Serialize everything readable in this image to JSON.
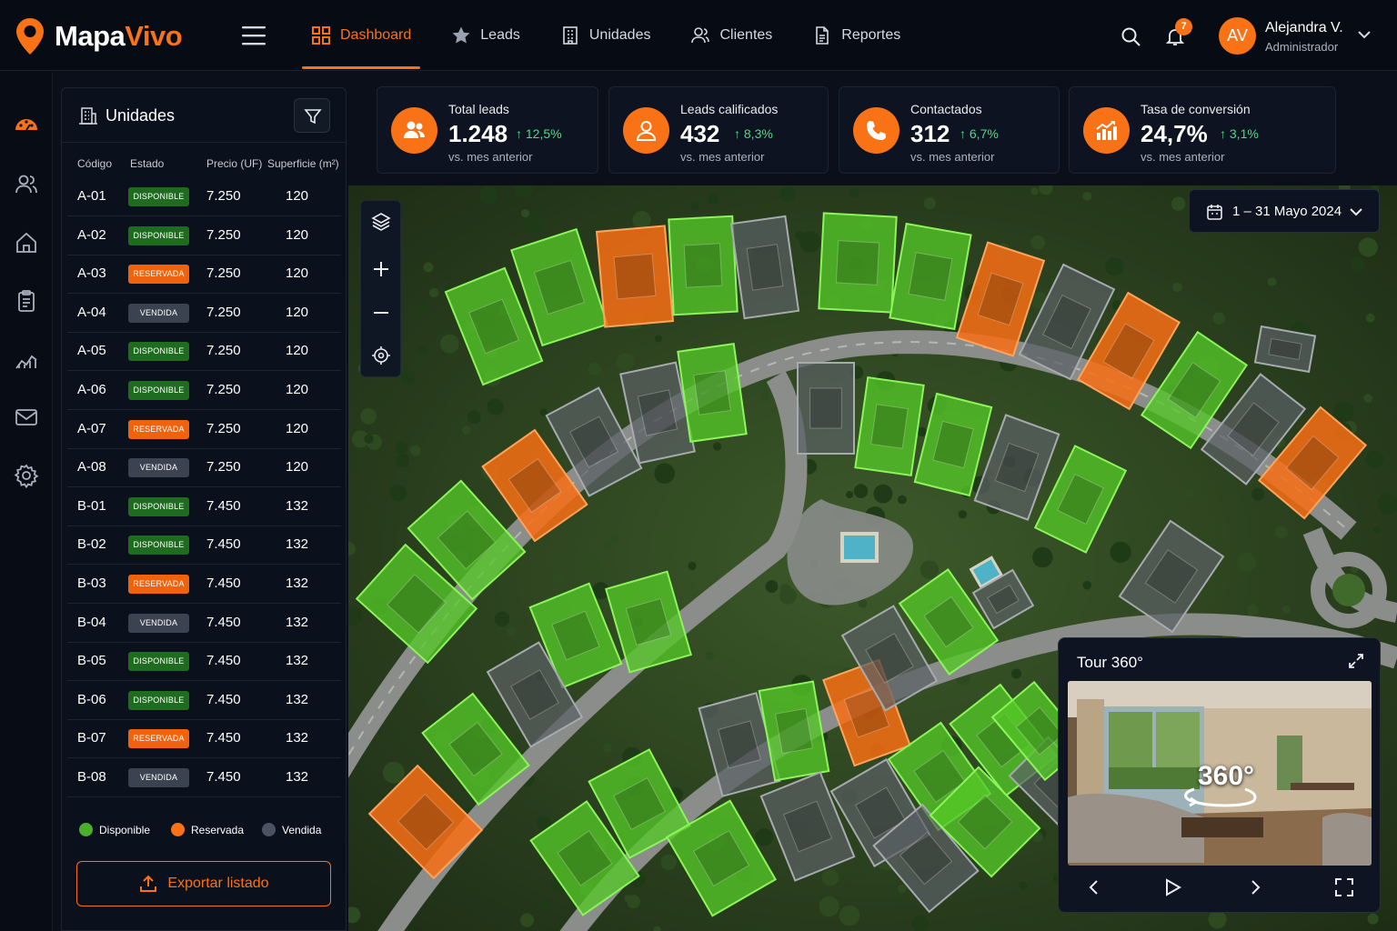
{
  "brand": {
    "name_a": "Mapa",
    "name_b": "Vivo",
    "accent": "#f97316"
  },
  "nav": [
    {
      "label": "Dashboard",
      "icon": "grid-icon",
      "active": true
    },
    {
      "label": "Leads",
      "icon": "star-icon"
    },
    {
      "label": "Unidades",
      "icon": "building-icon"
    },
    {
      "label": "Clientes",
      "icon": "users-icon"
    },
    {
      "label": "Reportes",
      "icon": "document-icon"
    }
  ],
  "user": {
    "initials": "AV",
    "name": "Alejandra V.",
    "role": "Administrador",
    "notifications": "7"
  },
  "rail": [
    "dashboard-icon",
    "users-icon",
    "home-icon",
    "clipboard-icon",
    "analytics-icon",
    "mail-icon",
    "settings-icon"
  ],
  "units_panel": {
    "title": "Unidades",
    "columns": [
      "Código",
      "Estado",
      "Precio (UF)",
      "Superficie (m²)"
    ],
    "rows": [
      {
        "code": "A-01",
        "status": "DISPONIBLE",
        "price": "7.250",
        "area": "120"
      },
      {
        "code": "A-02",
        "status": "DISPONIBLE",
        "price": "7.250",
        "area": "120"
      },
      {
        "code": "A-03",
        "status": "RESERVADA",
        "price": "7.250",
        "area": "120"
      },
      {
        "code": "A-04",
        "status": "VENDIDA",
        "price": "7.250",
        "area": "120"
      },
      {
        "code": "A-05",
        "status": "DISPONIBLE",
        "price": "7.250",
        "area": "120"
      },
      {
        "code": "A-06",
        "status": "DISPONIBLE",
        "price": "7.250",
        "area": "120"
      },
      {
        "code": "A-07",
        "status": "RESERVADA",
        "price": "7.250",
        "area": "120"
      },
      {
        "code": "A-08",
        "status": "VENDIDA",
        "price": "7.250",
        "area": "120"
      },
      {
        "code": "B-01",
        "status": "DISPONIBLE",
        "price": "7.450",
        "area": "132"
      },
      {
        "code": "B-02",
        "status": "DISPONIBLE",
        "price": "7.450",
        "area": "132"
      },
      {
        "code": "B-03",
        "status": "RESERVADA",
        "price": "7.450",
        "area": "132"
      },
      {
        "code": "B-04",
        "status": "VENDIDA",
        "price": "7.450",
        "area": "132"
      },
      {
        "code": "B-05",
        "status": "DISPONIBLE",
        "price": "7.450",
        "area": "132"
      },
      {
        "code": "B-06",
        "status": "DISPONIBLE",
        "price": "7.450",
        "area": "132"
      },
      {
        "code": "B-07",
        "status": "RESERVADA",
        "price": "7.450",
        "area": "132"
      },
      {
        "code": "B-08",
        "status": "VENDIDA",
        "price": "7.450",
        "area": "132"
      }
    ],
    "legend": [
      {
        "label": "Disponible",
        "color": "#4caf2a"
      },
      {
        "label": "Reservada",
        "color": "#f97316"
      },
      {
        "label": "Vendida",
        "color": "#4b5260"
      }
    ],
    "export_label": "Exportar listado"
  },
  "kpis": [
    {
      "label": "Total leads",
      "value": "1.248",
      "delta": "12,5%",
      "sub": "vs. mes anterior",
      "icon": "users-icon"
    },
    {
      "label": "Leads calificados",
      "value": "432",
      "delta": "8,3%",
      "sub": "vs. mes anterior",
      "icon": "user-icon"
    },
    {
      "label": "Contactados",
      "value": "312",
      "delta": "6,7%",
      "sub": "vs. mes anterior",
      "icon": "phone-icon"
    },
    {
      "label": "Tasa de conversión",
      "value": "24,7%",
      "delta": "3,1%",
      "sub": "vs. mes anterior",
      "icon": "chart-up-icon"
    }
  ],
  "date_range": "1 – 31 Mayo 2024",
  "tour": {
    "title": "Tour 360°",
    "overlay": "360°"
  }
}
